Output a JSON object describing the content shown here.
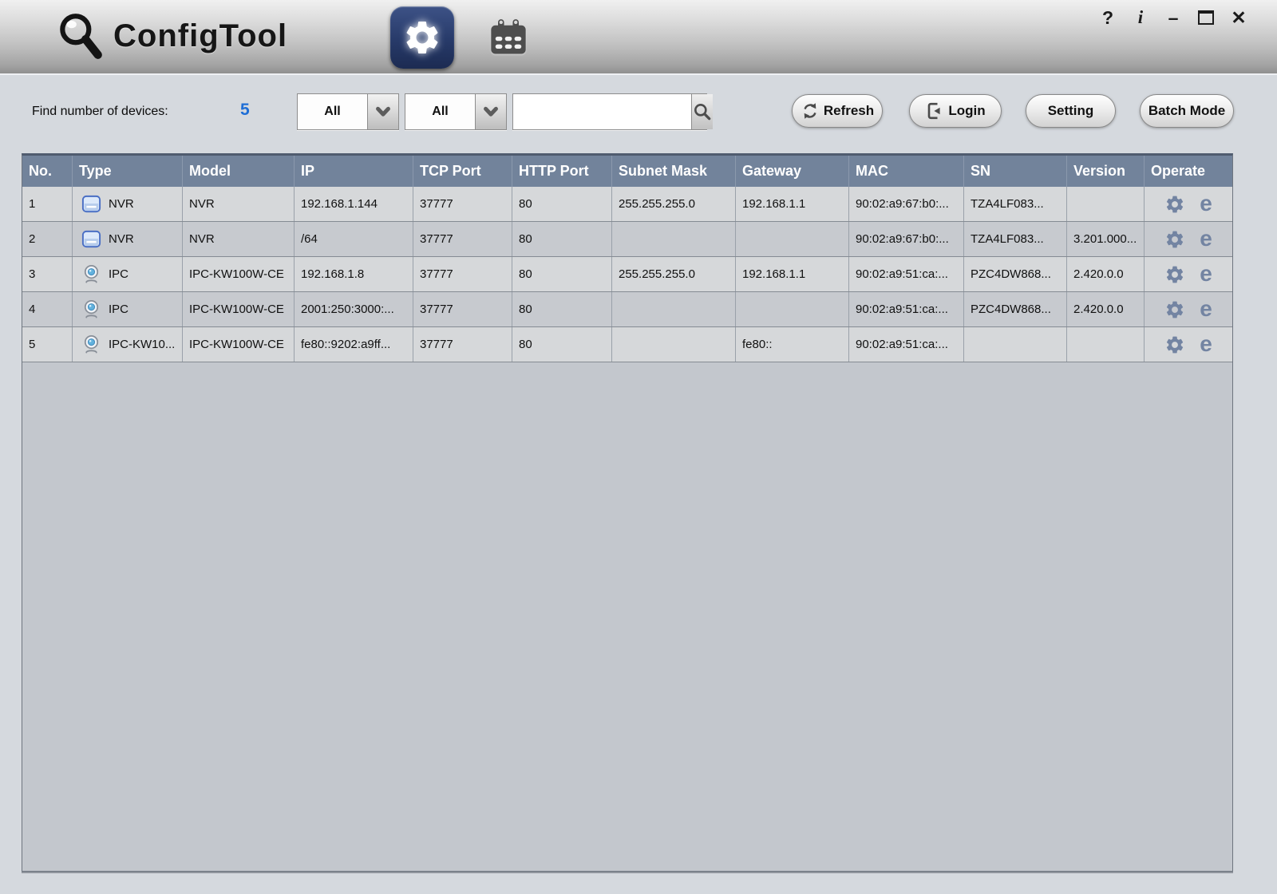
{
  "window": {
    "title": "ConfigTool",
    "controls": {
      "help": "?",
      "info": "i",
      "minimize": "–",
      "close": "✕"
    }
  },
  "toolbar": {
    "device_count_label": "Find number of devices:",
    "device_count": "5",
    "type_filter_value": "All",
    "protocol_filter_value": "All",
    "search_value": "",
    "refresh_label": "Refresh",
    "login_label": "Login",
    "setting_label": "Setting",
    "batch_mode_label": "Batch Mode"
  },
  "table": {
    "columns": [
      "No.",
      "Type",
      "Model",
      "IP",
      "TCP Port",
      "HTTP Port",
      "Subnet Mask",
      "Gateway",
      "MAC",
      "SN",
      "Version",
      "Operate"
    ],
    "rows": [
      {
        "no": "1",
        "type_icon": "nvr-icon",
        "type": "NVR",
        "model": "NVR",
        "ip": "192.168.1.144",
        "tcp_port": "37777",
        "http_port": "80",
        "subnet_mask": "255.255.255.0",
        "gateway": "192.168.1.1",
        "mac": "90:02:a9:67:b0:...",
        "sn": "TZA4LF083...",
        "version": ""
      },
      {
        "no": "2",
        "type_icon": "nvr-icon",
        "type": "NVR",
        "model": "NVR",
        "ip": "/64",
        "tcp_port": "37777",
        "http_port": "80",
        "subnet_mask": "",
        "gateway": "",
        "mac": "90:02:a9:67:b0:...",
        "sn": "TZA4LF083...",
        "version": "3.201.000..."
      },
      {
        "no": "3",
        "type_icon": "ipc-icon",
        "type": "IPC",
        "model": "IPC-KW100W-CE",
        "ip": "192.168.1.8",
        "tcp_port": "37777",
        "http_port": "80",
        "subnet_mask": "255.255.255.0",
        "gateway": "192.168.1.1",
        "mac": "90:02:a9:51:ca:...",
        "sn": "PZC4DW868...",
        "version": "2.420.0.0"
      },
      {
        "no": "4",
        "type_icon": "ipc-icon",
        "type": "IPC",
        "model": "IPC-KW100W-CE",
        "ip": "2001:250:3000:...",
        "tcp_port": "37777",
        "http_port": "80",
        "subnet_mask": "",
        "gateway": "",
        "mac": "90:02:a9:51:ca:...",
        "sn": "PZC4DW868...",
        "version": "2.420.0.0"
      },
      {
        "no": "5",
        "type_icon": "ipc-icon",
        "type": "IPC-KW10...",
        "model": "IPC-KW100W-CE",
        "ip": "fe80::9202:a9ff...",
        "tcp_port": "37777",
        "http_port": "80",
        "subnet_mask": "",
        "gateway": "fe80::",
        "mac": "90:02:a9:51:ca:...",
        "sn": "",
        "version": ""
      }
    ],
    "operate": {
      "settings_icon": "gear-icon",
      "browser_icon": "ie-browser-icon",
      "browser_glyph": "e"
    }
  },
  "colors": {
    "accent_blue": "#1e6ed6",
    "header_bg": "#72839b",
    "operate_icon": "#7384a2",
    "selected_tab_bg": "#24345c"
  }
}
